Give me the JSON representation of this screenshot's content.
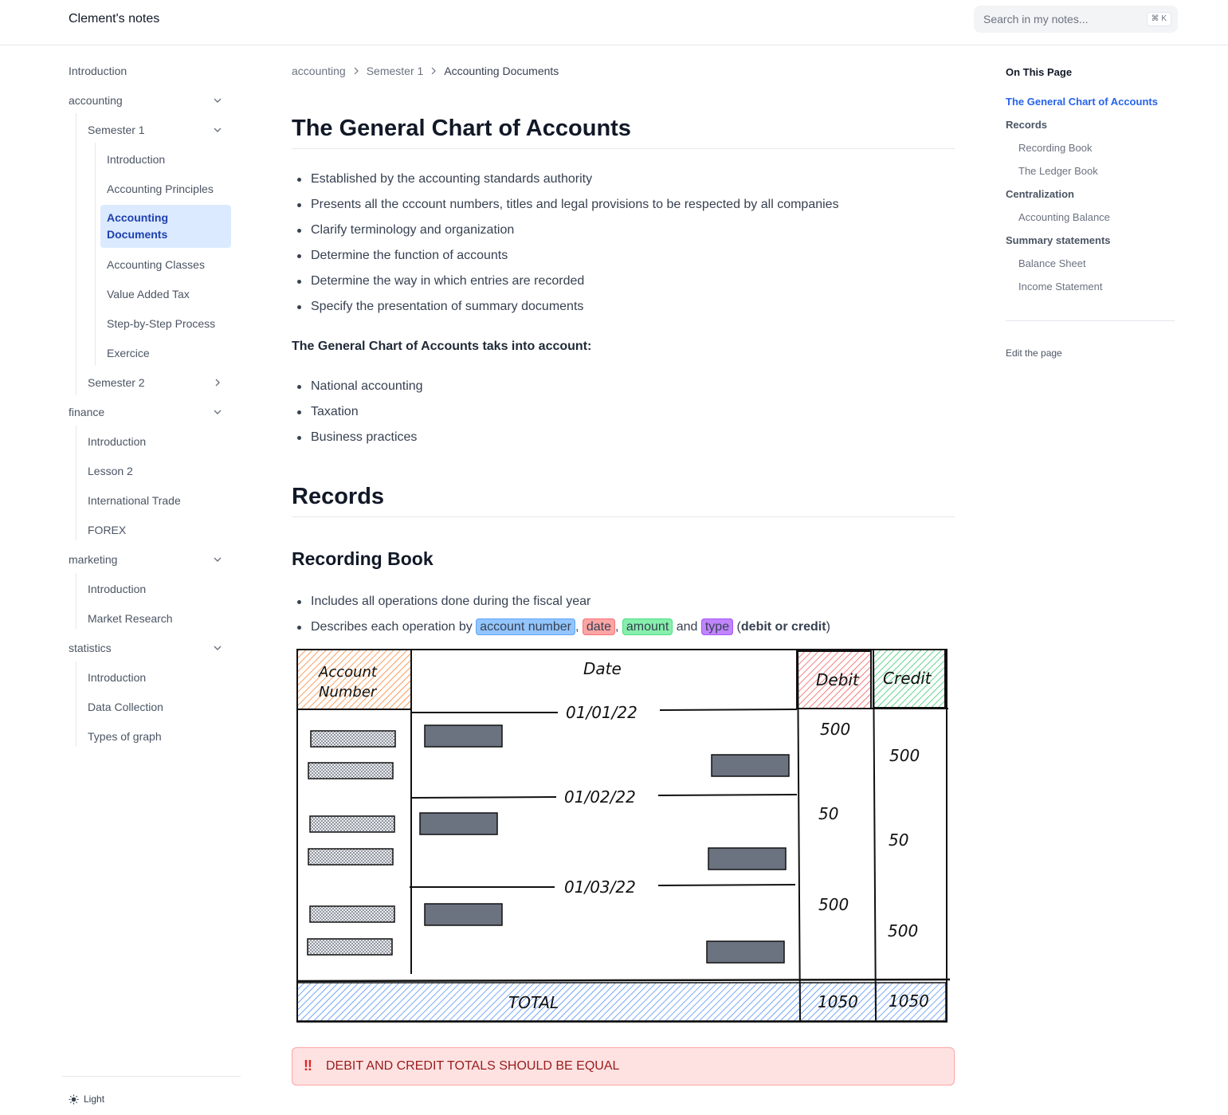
{
  "header": {
    "site_title": "Clement's notes",
    "search_placeholder": "Search in my notes...",
    "search_shortcut": "⌘ K"
  },
  "sidebar": {
    "items": [
      {
        "label": "Introduction"
      },
      {
        "label": "accounting"
      },
      {
        "label": "Semester 1"
      },
      {
        "label": "Introduction"
      },
      {
        "label": "Accounting Principles"
      },
      {
        "label": "Accounting Documents"
      },
      {
        "label": "Accounting Classes"
      },
      {
        "label": "Value Added Tax"
      },
      {
        "label": "Step-by-Step Process"
      },
      {
        "label": "Exercice"
      },
      {
        "label": "Semester 2"
      },
      {
        "label": "finance"
      },
      {
        "label": "Introduction"
      },
      {
        "label": "Lesson 2"
      },
      {
        "label": "International Trade"
      },
      {
        "label": "FOREX"
      },
      {
        "label": "marketing"
      },
      {
        "label": "Introduction"
      },
      {
        "label": "Market Research"
      },
      {
        "label": "statistics"
      },
      {
        "label": "Introduction"
      },
      {
        "label": "Data Collection"
      },
      {
        "label": "Types of graph"
      }
    ],
    "theme_label": "Light",
    "icons": {
      "expanded": "chevron-down-icon",
      "collapsed": "chevron-right-icon",
      "theme": "sun-icon"
    }
  },
  "breadcrumb": [
    "accounting",
    "Semester 1",
    "Accounting Documents"
  ],
  "content": {
    "h1": "The General Chart of Accounts",
    "bullets1": [
      "Established by the accounting standards authority",
      "Presents all the cccount numbers, titles and legal provisions to be respected by all companies",
      "Clarify terminology and organization",
      "Determine the function of accounts",
      "Determine the way in which entries are recorded",
      "Specify the presentation of summary documents"
    ],
    "bold_para": "The General Chart of Accounts taks into account:",
    "bullets2": [
      "National accounting",
      "Taxation",
      "Business practices"
    ],
    "h2": "Records",
    "h3": "Recording Book",
    "bullets3_first": "Includes all operations done during the fiscal year",
    "bullets3_second": {
      "prefix": "Describes each operation by ",
      "tag_account": "account number",
      "comma1": ", ",
      "tag_date": "date",
      "comma2": ", ",
      "tag_amount": "amount",
      "and": " and ",
      "tag_type": "type",
      "open": " (",
      "bold": "debit or credit",
      "close": ")"
    },
    "sketch": {
      "header_account_line1": "Account",
      "header_account_line2": "Number",
      "header_date": "Date",
      "header_debit": "Debit",
      "header_credit": "Credit",
      "dates": [
        "01/01/22",
        "01/02/22",
        "01/03/22"
      ],
      "debits": [
        "500",
        "50",
        "500"
      ],
      "credits": [
        "500",
        "50",
        "500"
      ],
      "total_label": "TOTAL",
      "total_debit": "1050",
      "total_credit": "1050",
      "colors": {
        "account": "#f97316",
        "debit": "#ef4444",
        "credit": "#22c55e",
        "total": "#3b82f6",
        "block": "#6b7280"
      }
    },
    "alert": {
      "icon": "‼",
      "text": "DEBIT AND CREDIT TOTALS SHOULD BE EQUAL"
    }
  },
  "toc": {
    "title": "On This Page",
    "items": [
      {
        "label": "The General Chart of Accounts",
        "level": 1,
        "active": true
      },
      {
        "label": "Records",
        "level": 1
      },
      {
        "label": "Recording Book",
        "level": 2
      },
      {
        "label": "The Ledger Book",
        "level": 2
      },
      {
        "label": "Centralization",
        "level": 1
      },
      {
        "label": "Accounting Balance",
        "level": 2
      },
      {
        "label": "Summary statements",
        "level": 1
      },
      {
        "label": "Balance Sheet",
        "level": 2
      },
      {
        "label": "Income Statement",
        "level": 2
      }
    ],
    "edit_label": "Edit the page"
  }
}
